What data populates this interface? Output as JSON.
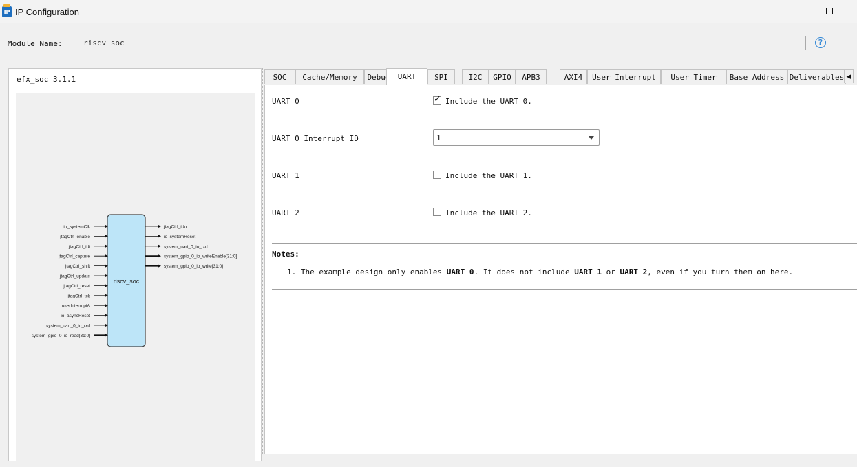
{
  "window": {
    "title": "IP Configuration",
    "minimize_icon": "minimize-icon",
    "maximize_icon": "maximize-icon"
  },
  "module": {
    "label": "Module Name:",
    "value": "riscv_soc"
  },
  "left_panel": {
    "version": "efx_soc 3.1.1",
    "block_name": "riscv_soc",
    "inputs": [
      {
        "label": "io_systemClk",
        "bus": false
      },
      {
        "label": "jtagCtrl_enable",
        "bus": false
      },
      {
        "label": "jtagCtrl_tdi",
        "bus": false
      },
      {
        "label": "jtagCtrl_capture",
        "bus": false
      },
      {
        "label": "jtagCtrl_shift",
        "bus": false
      },
      {
        "label": "jtagCtrl_update",
        "bus": false
      },
      {
        "label": "jtagCtrl_reset",
        "bus": false
      },
      {
        "label": "jtagCtrl_tck",
        "bus": false
      },
      {
        "label": "userInterruptA",
        "bus": false
      },
      {
        "label": "io_asyncReset",
        "bus": false
      },
      {
        "label": "system_uart_0_io_rxd",
        "bus": false
      },
      {
        "label": "system_gpio_0_io_read[31:0]",
        "bus": true
      }
    ],
    "outputs": [
      {
        "label": "jtagCtrl_tdo",
        "bus": false
      },
      {
        "label": "io_systemReset",
        "bus": false
      },
      {
        "label": "system_uart_0_io_txd",
        "bus": false
      },
      {
        "label": "system_gpio_0_io_writeEnable[31:0]",
        "bus": true
      },
      {
        "label": "system_gpio_0_io_write[31:0]",
        "bus": true
      }
    ],
    "colors": {
      "block_fill": "#bde5f8",
      "block_stroke": "#444444"
    }
  },
  "tabs": [
    {
      "label": "SOC"
    },
    {
      "label": "Cache/Memory"
    },
    {
      "label": "Debug"
    },
    {
      "label": "UART"
    },
    {
      "label": "SPI"
    },
    {
      "label": "I2C"
    },
    {
      "label": "GPIO"
    },
    {
      "label": "APB3"
    },
    {
      "label": "AXI4"
    },
    {
      "label": "User Interrupt"
    },
    {
      "label": "User Timer"
    },
    {
      "label": "Base Address"
    },
    {
      "label": "Deliverables"
    }
  ],
  "active_tab": "UART",
  "uart": {
    "uart0_label": "UART 0",
    "uart0_check_label": "Include the UART 0.",
    "uart0_checked": true,
    "interrupt_label": "UART 0 Interrupt ID",
    "interrupt_value": "1",
    "uart1_label": "UART 1",
    "uart1_check_label": "Include the UART 1.",
    "uart1_checked": false,
    "uart2_label": "UART 2",
    "uart2_check_label": "Include the UART 2.",
    "uart2_checked": false
  },
  "notes": {
    "title": "Notes:",
    "num": "1.",
    "p1": "The example design only enables ",
    "b1": "UART 0",
    "p2": ". It does not include ",
    "b2": "UART 1",
    "p3": " or ",
    "b3": "UART 2",
    "p4": ", even if you turn them on here."
  }
}
